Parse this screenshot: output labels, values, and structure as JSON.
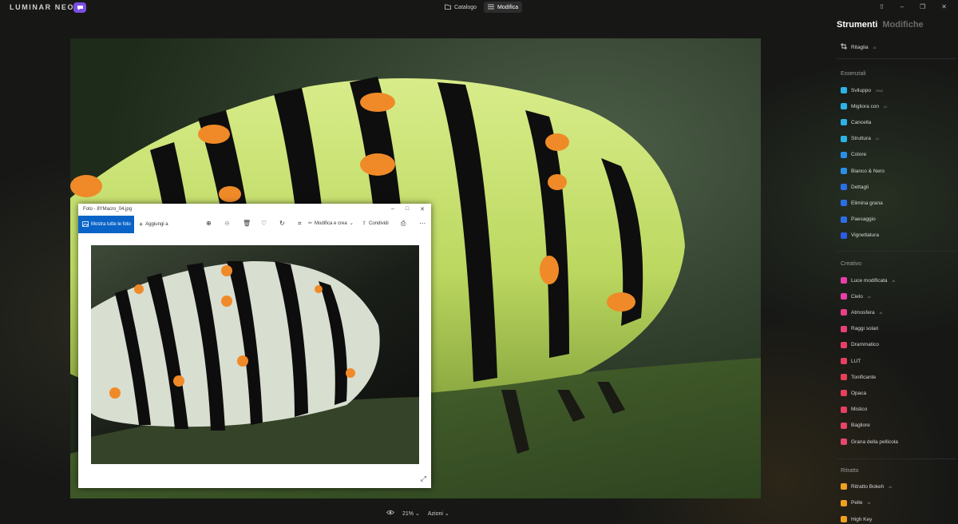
{
  "app": {
    "logo_text": "LUMINAR NEO",
    "tabs": [
      {
        "label": "Catalogo",
        "icon": "folder-icon",
        "active": false
      },
      {
        "label": "Modifica",
        "icon": "sliders-icon",
        "active": true
      }
    ]
  },
  "panel": {
    "tab_active": "Strumenti",
    "tab_inactive": "Modifiche",
    "crop_label": "Ritaglia",
    "sections": {
      "essentials": "Essenziali",
      "creative": "Creativo",
      "portrait": "Ritratto"
    },
    "essentials": [
      {
        "label": "Sviluppo",
        "sup": "RAW",
        "color": "#2bb3e6"
      },
      {
        "label": "Migliora con",
        "sup": "AI",
        "color": "#2bb3e6"
      },
      {
        "label": "Cancella",
        "sup": "",
        "color": "#2bb3e6"
      },
      {
        "label": "Struttura",
        "sup": "AI",
        "color": "#2bb3e6"
      },
      {
        "label": "Colore",
        "sup": "",
        "color": "#2b8ee6"
      },
      {
        "label": "Bianco & Nero",
        "sup": "",
        "color": "#2b8ee6"
      },
      {
        "label": "Dettagli",
        "sup": "",
        "color": "#2b6fe6"
      },
      {
        "label": "Elimina grana",
        "sup": "",
        "color": "#2b6fe6"
      },
      {
        "label": "Paesaggio",
        "sup": "",
        "color": "#2b6fe6"
      },
      {
        "label": "Vignettatura",
        "sup": "",
        "color": "#2b5ce6"
      }
    ],
    "creative": [
      {
        "label": "Luce modificata",
        "sup": "AI",
        "color": "#e640a8"
      },
      {
        "label": "Cielo",
        "sup": "AI",
        "color": "#e640a8"
      },
      {
        "label": "Atmosfera",
        "sup": "AI",
        "color": "#e64088"
      },
      {
        "label": "Raggi solari",
        "sup": "",
        "color": "#e64078"
      },
      {
        "label": "Drammatico",
        "sup": "",
        "color": "#e64068"
      },
      {
        "label": "LUT",
        "sup": "",
        "color": "#e64060"
      },
      {
        "label": "Tonificante",
        "sup": "",
        "color": "#e64058"
      },
      {
        "label": "Opaca",
        "sup": "",
        "color": "#e6405a"
      },
      {
        "label": "Mistico",
        "sup": "",
        "color": "#e64060"
      },
      {
        "label": "Bagliore",
        "sup": "",
        "color": "#e64468"
      },
      {
        "label": "Grana della pellicola",
        "sup": "",
        "color": "#e64870"
      }
    ],
    "portrait": [
      {
        "label": "Ritratto Bokeh",
        "sup": "AI",
        "color": "#f0a020"
      },
      {
        "label": "Pelle",
        "sup": "AI",
        "color": "#f0a020"
      },
      {
        "label": "High Key",
        "sup": "",
        "color": "#f0a020"
      }
    ]
  },
  "bottom": {
    "zoom": "21%",
    "actions": "Azioni"
  },
  "viewer": {
    "title": "Foto - 8YMacro_04.jpg",
    "show_all": "Mostra tutte le foto",
    "add_to": "Aggiungi a",
    "edit_create": "Modifica e crea",
    "share": "Condividi"
  }
}
